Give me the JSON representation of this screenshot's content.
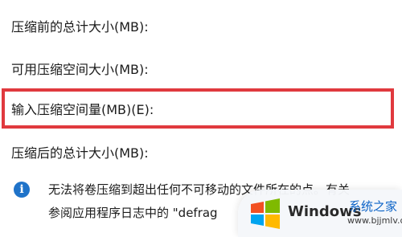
{
  "fields": {
    "total_before": "压缩前的总计大小(MB):",
    "available_space": "可用压缩空间大小(MB):",
    "input_amount": "输入压缩空间量(MB)(E):",
    "total_after": "压缩后的总计大小(MB):"
  },
  "info": {
    "icon": "info-icon",
    "line1": "无法将卷压缩到超出任何不可移动的文件所在的点。有关",
    "line2": "参阅应用程序日志中的 \"defrag"
  },
  "watermark": {
    "brand": "Windows",
    "cn": "系统之家",
    "url": "www.bjjmlv.com"
  },
  "colors": {
    "highlight": "#e0393e",
    "info": "#1f73c9"
  }
}
